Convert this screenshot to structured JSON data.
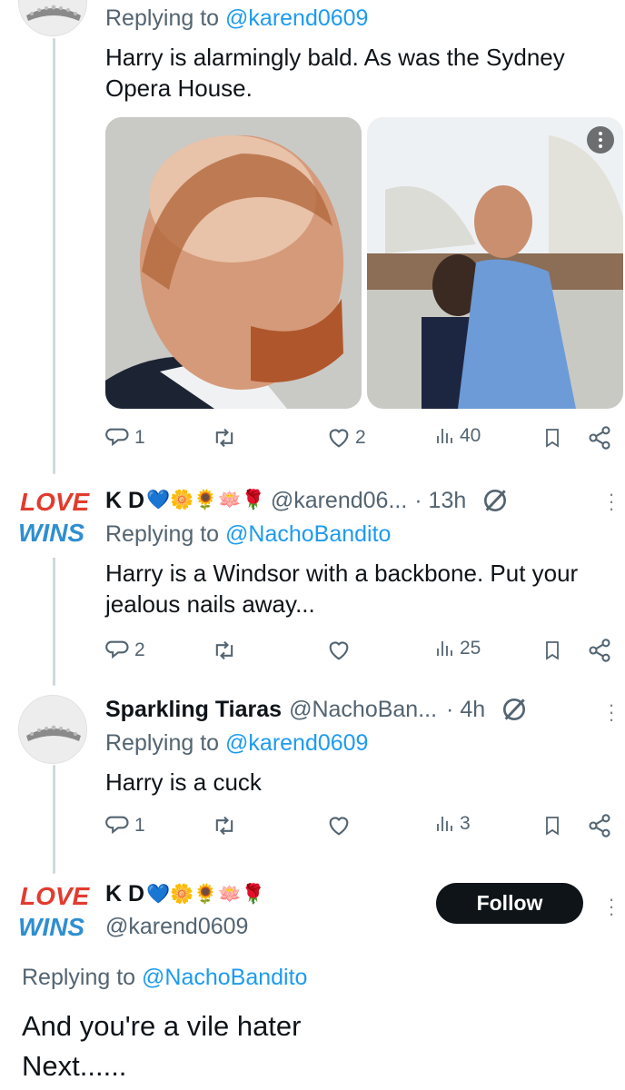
{
  "reply1": {
    "replying_prefix": "Replying to",
    "replying_handle": "@karend0609",
    "text_line1": "Harry is alarmingly bald. As was the Sydney",
    "text_line2": "Opera House.",
    "stats": {
      "replies": "1",
      "retweets": "",
      "likes": "2",
      "views": "40"
    }
  },
  "reply2": {
    "name": "K D",
    "emojis": "💙🌼🌻🪷🌹",
    "handle": "@karend06...",
    "time": "· 13h",
    "replying_prefix": "Replying to",
    "replying_handle": "@NachoBandito",
    "text_line1": "Harry is a Windsor with a backbone. Put your",
    "text_line2": "jealous nails away...",
    "stats": {
      "replies": "2",
      "retweets": "",
      "likes": "",
      "views": "25"
    }
  },
  "reply3": {
    "name": "Sparkling Tiaras",
    "handle": "@NachoBan...",
    "time": "· 4h",
    "replying_prefix": "Replying to",
    "replying_handle": "@karend0609",
    "text": "Harry is a cuck",
    "stats": {
      "replies": "1",
      "retweets": "",
      "likes": "",
      "views": "3"
    }
  },
  "main": {
    "name": "K D",
    "emojis": "💙🌼🌻🪷🌹",
    "handle": "@karend0609",
    "follow_label": "Follow",
    "replying_prefix": "Replying to",
    "replying_handle": "@NachoBandito",
    "text_line1": "And you're a vile hater",
    "text_line2": "Next......"
  },
  "avatar_love": {
    "line1": "LOVE",
    "line2": "WINS"
  },
  "colors": {
    "link": "#1d9bf0",
    "muted": "#536471",
    "text": "#0f1419",
    "thread": "#cfd9de"
  }
}
